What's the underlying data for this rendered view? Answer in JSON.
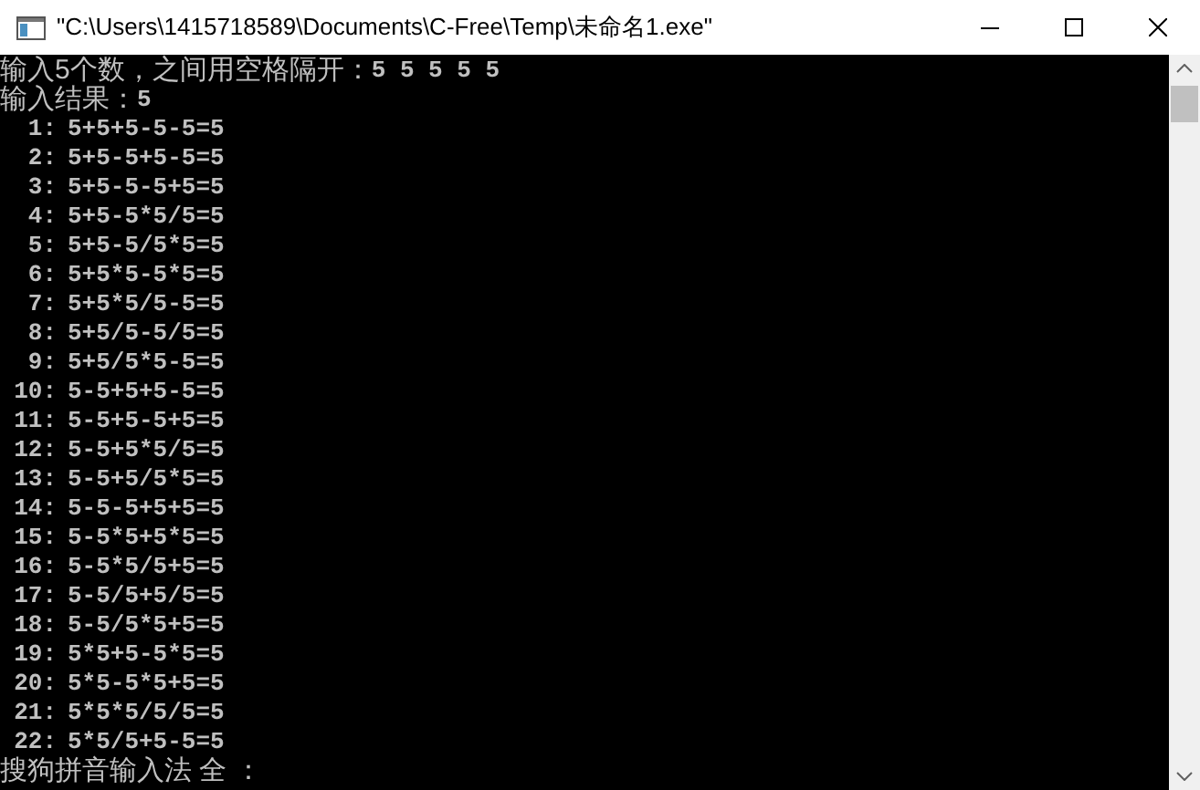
{
  "window": {
    "title": "\"C:\\Users\\1415718589\\Documents\\C-Free\\Temp\\未命名1.exe\""
  },
  "console": {
    "prompt": "输入5个数，之间用空格隔开：",
    "input": "5 5 5 5 5",
    "result_label": "输入结果：",
    "result": "5",
    "rows": [
      {
        "index": "1:",
        "expression": "5+5+5-5-5=5"
      },
      {
        "index": "2:",
        "expression": "5+5-5+5-5=5"
      },
      {
        "index": "3:",
        "expression": "5+5-5-5+5=5"
      },
      {
        "index": "4:",
        "expression": "5+5-5*5/5=5"
      },
      {
        "index": "5:",
        "expression": "5+5-5/5*5=5"
      },
      {
        "index": "6:",
        "expression": "5+5*5-5*5=5"
      },
      {
        "index": "7:",
        "expression": "5+5*5/5-5=5"
      },
      {
        "index": "8:",
        "expression": "5+5/5-5/5=5"
      },
      {
        "index": "9:",
        "expression": "5+5/5*5-5=5"
      },
      {
        "index": "10:",
        "expression": "5-5+5+5-5=5"
      },
      {
        "index": "11:",
        "expression": "5-5+5-5+5=5"
      },
      {
        "index": "12:",
        "expression": "5-5+5*5/5=5"
      },
      {
        "index": "13:",
        "expression": "5-5+5/5*5=5"
      },
      {
        "index": "14:",
        "expression": "5-5-5+5+5=5"
      },
      {
        "index": "15:",
        "expression": "5-5*5+5*5=5"
      },
      {
        "index": "16:",
        "expression": "5-5*5/5+5=5"
      },
      {
        "index": "17:",
        "expression": "5-5/5+5/5=5"
      },
      {
        "index": "18:",
        "expression": "5-5/5*5+5=5"
      },
      {
        "index": "19:",
        "expression": "5*5+5-5*5=5"
      },
      {
        "index": "20:",
        "expression": "5*5-5*5+5=5"
      },
      {
        "index": "21:",
        "expression": "5*5*5/5/5=5"
      },
      {
        "index": "22:",
        "expression": "5*5/5+5-5=5"
      }
    ],
    "ime_status": "搜狗拼音输入法 全 ："
  }
}
